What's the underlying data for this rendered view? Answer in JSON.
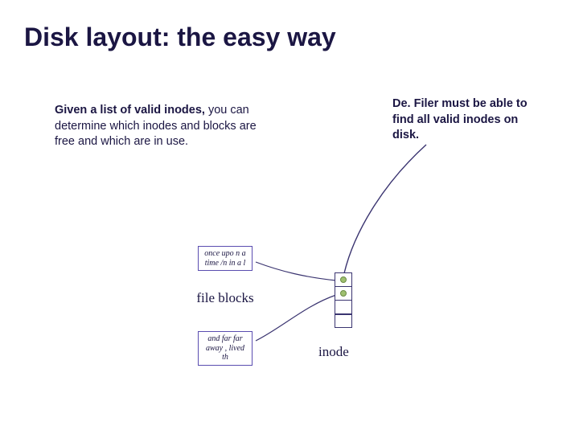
{
  "title": "Disk layout: the easy way",
  "left_block": {
    "bold": "Given a list of valid inodes,",
    "rest": " you can determine which inodes and blocks are free and which are in use."
  },
  "right_block": "De. Filer must be able to find all valid inodes on disk.",
  "snippets": {
    "top": "once upo n a time /n in a l",
    "bottom": "and far far away , lived th"
  },
  "labels": {
    "file_blocks": "file blocks",
    "inode": "inode"
  },
  "colors": {
    "heading": "#1b1643",
    "box_border": "#5a4db0",
    "dot_fill": "#9fc070"
  }
}
